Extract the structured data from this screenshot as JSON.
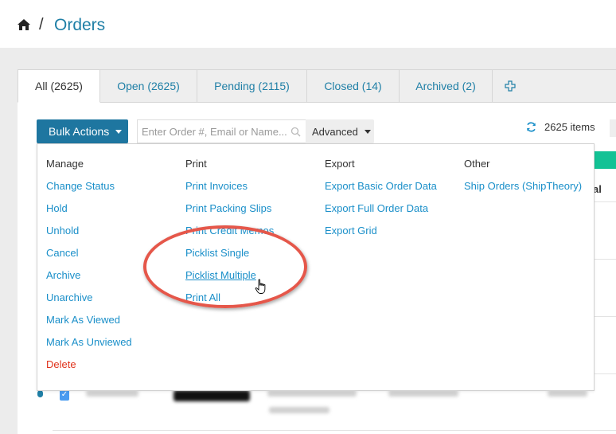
{
  "breadcrumb": {
    "home_icon": "home-icon",
    "separator": "/",
    "title": "Orders"
  },
  "tabs": [
    {
      "label": "All (2625)",
      "active": true
    },
    {
      "label": "Open (2625)",
      "active": false
    },
    {
      "label": "Pending (2115)",
      "active": false
    },
    {
      "label": "Closed (14)",
      "active": false
    },
    {
      "label": "Archived (2)",
      "active": false
    }
  ],
  "add_tab_icon": "plus-icon",
  "toolbar": {
    "bulk_actions_label": "Bulk Actions",
    "search_placeholder": "Enter Order #, Email or Name...",
    "advanced_label": "Advanced",
    "items_count": "2625 items",
    "refresh_icon": "refresh-icon"
  },
  "bulk_menu": {
    "columns": [
      {
        "heading": "Manage",
        "items": [
          "Change Status",
          "Hold",
          "Unhold",
          "Cancel",
          "Archive",
          "Unarchive",
          "Mark As Viewed",
          "Mark As Unviewed",
          "Delete"
        ]
      },
      {
        "heading": "Print",
        "items": [
          "Print Invoices",
          "Print Packing Slips",
          "Print Credit Memos",
          "Picklist Single",
          "Picklist Multiple",
          "Print All"
        ]
      },
      {
        "heading": "Export",
        "items": [
          "Export Basic Order Data",
          "Export Full Order Data",
          "Export Grid"
        ]
      },
      {
        "heading": "Other",
        "items": [
          "Ship Orders (ShipTheory)"
        ]
      }
    ],
    "hovered_item": "Picklist Multiple",
    "danger_item": "Delete"
  },
  "table_peek": {
    "column_fragment": "al"
  },
  "colors": {
    "link": "#1a8fc9",
    "brand": "#1e76a0",
    "danger": "#e0321b",
    "success": "#13c295",
    "annotation": "#e5574a"
  }
}
